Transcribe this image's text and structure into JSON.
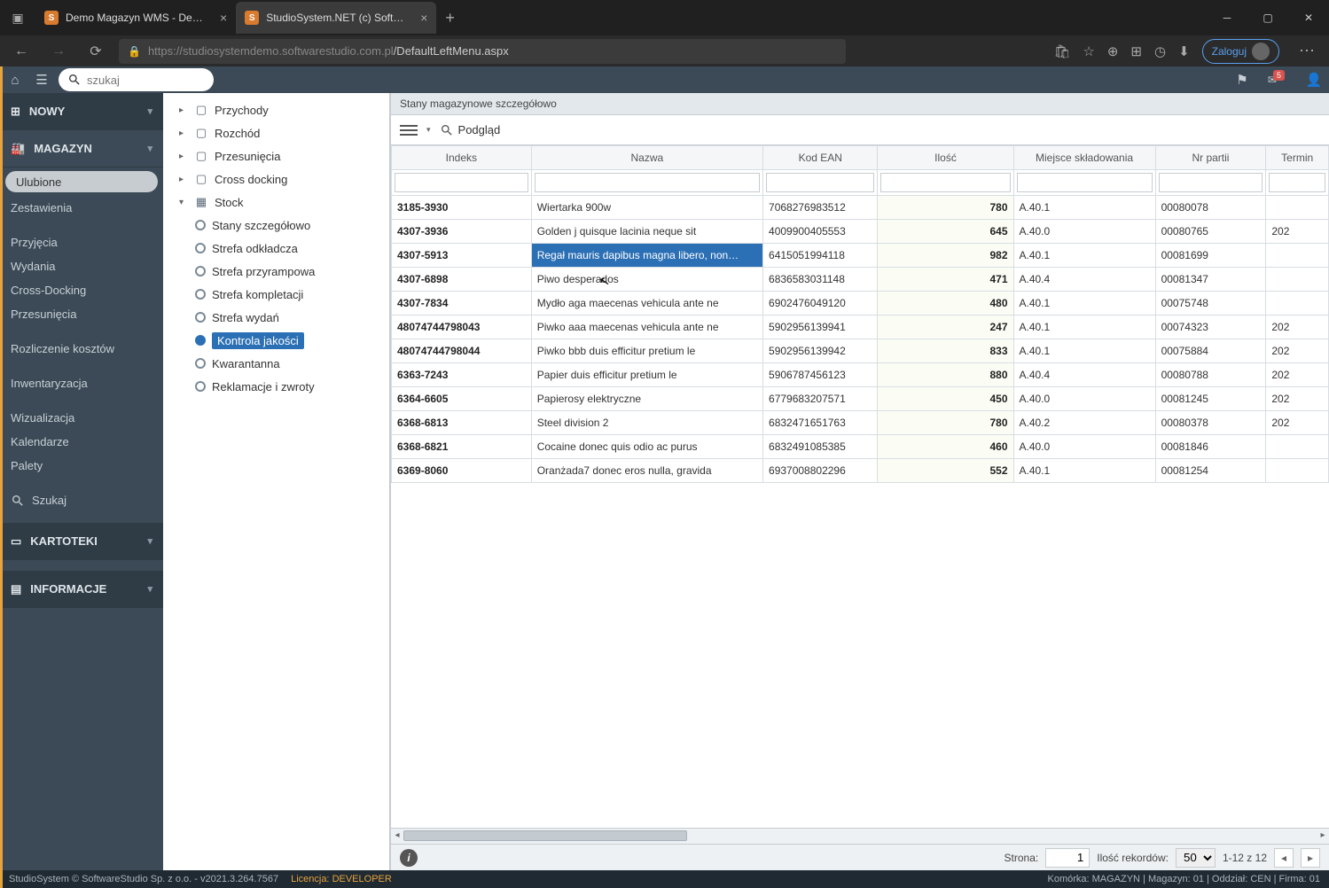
{
  "browser": {
    "tabs": [
      {
        "title": "Demo Magazyn WMS - Demo o…"
      },
      {
        "title": "StudioSystem.NET (c) SoftwareSt…"
      }
    ],
    "url_host": "https://studiosystemdemo.softwarestudio.com.pl",
    "url_path": "/DefaultLeftMenu.aspx",
    "login": "Zaloguj"
  },
  "topbar": {
    "search_placeholder": "szukaj",
    "mail_badge": "5"
  },
  "sidebar": {
    "nowy": "NOWY",
    "magazyn": "MAGAZYN",
    "kartoteki": "KARTOTEKI",
    "informacje": "INFORMACJE",
    "items": [
      "Ulubione",
      "Zestawienia",
      "Przyjęcia",
      "Wydania",
      "Cross-Docking",
      "Przesunięcia",
      "Rozliczenie kosztów",
      "Inwentaryzacja",
      "Wizualizacja",
      "Kalendarze",
      "Palety",
      "Szukaj"
    ]
  },
  "tree": {
    "top": [
      "Przychody",
      "Rozchód",
      "Przesunięcia",
      "Cross docking"
    ],
    "stock": "Stock",
    "stock_items": [
      "Stany szczegółowo",
      "Strefa odkładcza",
      "Strefa przyrampowa",
      "Strefa kompletacji",
      "Strefa wydań",
      "Kontrola jakości",
      "Kwarantanna",
      "Reklamacje i zwroty"
    ]
  },
  "content": {
    "title": "Stany magazynowe szczegółowo",
    "preview": "Podgląd",
    "columns": [
      "Indeks",
      "Nazwa",
      "Kod EAN",
      "Ilość",
      "Miejsce składowania",
      "Nr partii",
      "Termin"
    ],
    "rows": [
      {
        "idx": "3185-3930",
        "name": "Wiertarka 900w",
        "ean": "7068276983512",
        "qty": "780",
        "loc": "A.40.1",
        "batch": "00080078",
        "term": ""
      },
      {
        "idx": "4307-3936",
        "name": "Golden j quisque lacinia neque sit",
        "ean": "4009900405553",
        "qty": "645",
        "loc": "A.40.0",
        "batch": "00080765",
        "term": "202"
      },
      {
        "idx": "4307-5913",
        "name": "Regał mauris dapibus magna libero, non…",
        "ean": "6415051994118",
        "qty": "982",
        "loc": "A.40.1",
        "batch": "00081699",
        "term": ""
      },
      {
        "idx": "4307-6898",
        "name": "Piwo desperados",
        "ean": "6836583031148",
        "qty": "471",
        "loc": "A.40.4",
        "batch": "00081347",
        "term": ""
      },
      {
        "idx": "4307-7834",
        "name": "Mydło aga maecenas vehicula ante ne",
        "ean": "6902476049120",
        "qty": "480",
        "loc": "A.40.1",
        "batch": "00075748",
        "term": ""
      },
      {
        "idx": "48074744798043",
        "name": "Piwko aaa maecenas vehicula ante ne",
        "ean": "5902956139941",
        "qty": "247",
        "loc": "A.40.1",
        "batch": "00074323",
        "term": "202"
      },
      {
        "idx": "48074744798044",
        "name": "Piwko bbb duis efficitur pretium le",
        "ean": "5902956139942",
        "qty": "833",
        "loc": "A.40.1",
        "batch": "00075884",
        "term": "202"
      },
      {
        "idx": "6363-7243",
        "name": "Papier duis efficitur pretium le",
        "ean": "5906787456123",
        "qty": "880",
        "loc": "A.40.4",
        "batch": "00080788",
        "term": "202"
      },
      {
        "idx": "6364-6605",
        "name": "Papierosy elektryczne",
        "ean": "6779683207571",
        "qty": "450",
        "loc": "A.40.0",
        "batch": "00081245",
        "term": "202"
      },
      {
        "idx": "6368-6813",
        "name": "Steel division 2",
        "ean": "6832471651763",
        "qty": "780",
        "loc": "A.40.2",
        "batch": "00080378",
        "term": "202"
      },
      {
        "idx": "6368-6821",
        "name": "Cocaine donec quis odio ac purus",
        "ean": "6832491085385",
        "qty": "460",
        "loc": "A.40.0",
        "batch": "00081846",
        "term": ""
      },
      {
        "idx": "6369-8060",
        "name": "Oranżada7 donec eros nulla, gravida",
        "ean": "6937008802296",
        "qty": "552",
        "loc": "A.40.1",
        "batch": "00081254",
        "term": ""
      }
    ],
    "pager": {
      "page_label": "Strona:",
      "page": "1",
      "records_label": "Ilość rekordów:",
      "records": "50",
      "range": "1-12 z 12"
    }
  },
  "footer": {
    "left": "StudioSystem © SoftwareStudio Sp. z o.o. - v2021.3.264.7567",
    "license_label": "Licencja:",
    "license": "DEVELOPER",
    "right": "Komórka: MAGAZYN | Magazyn: 01 | Oddział: CEN | Firma: 01"
  }
}
